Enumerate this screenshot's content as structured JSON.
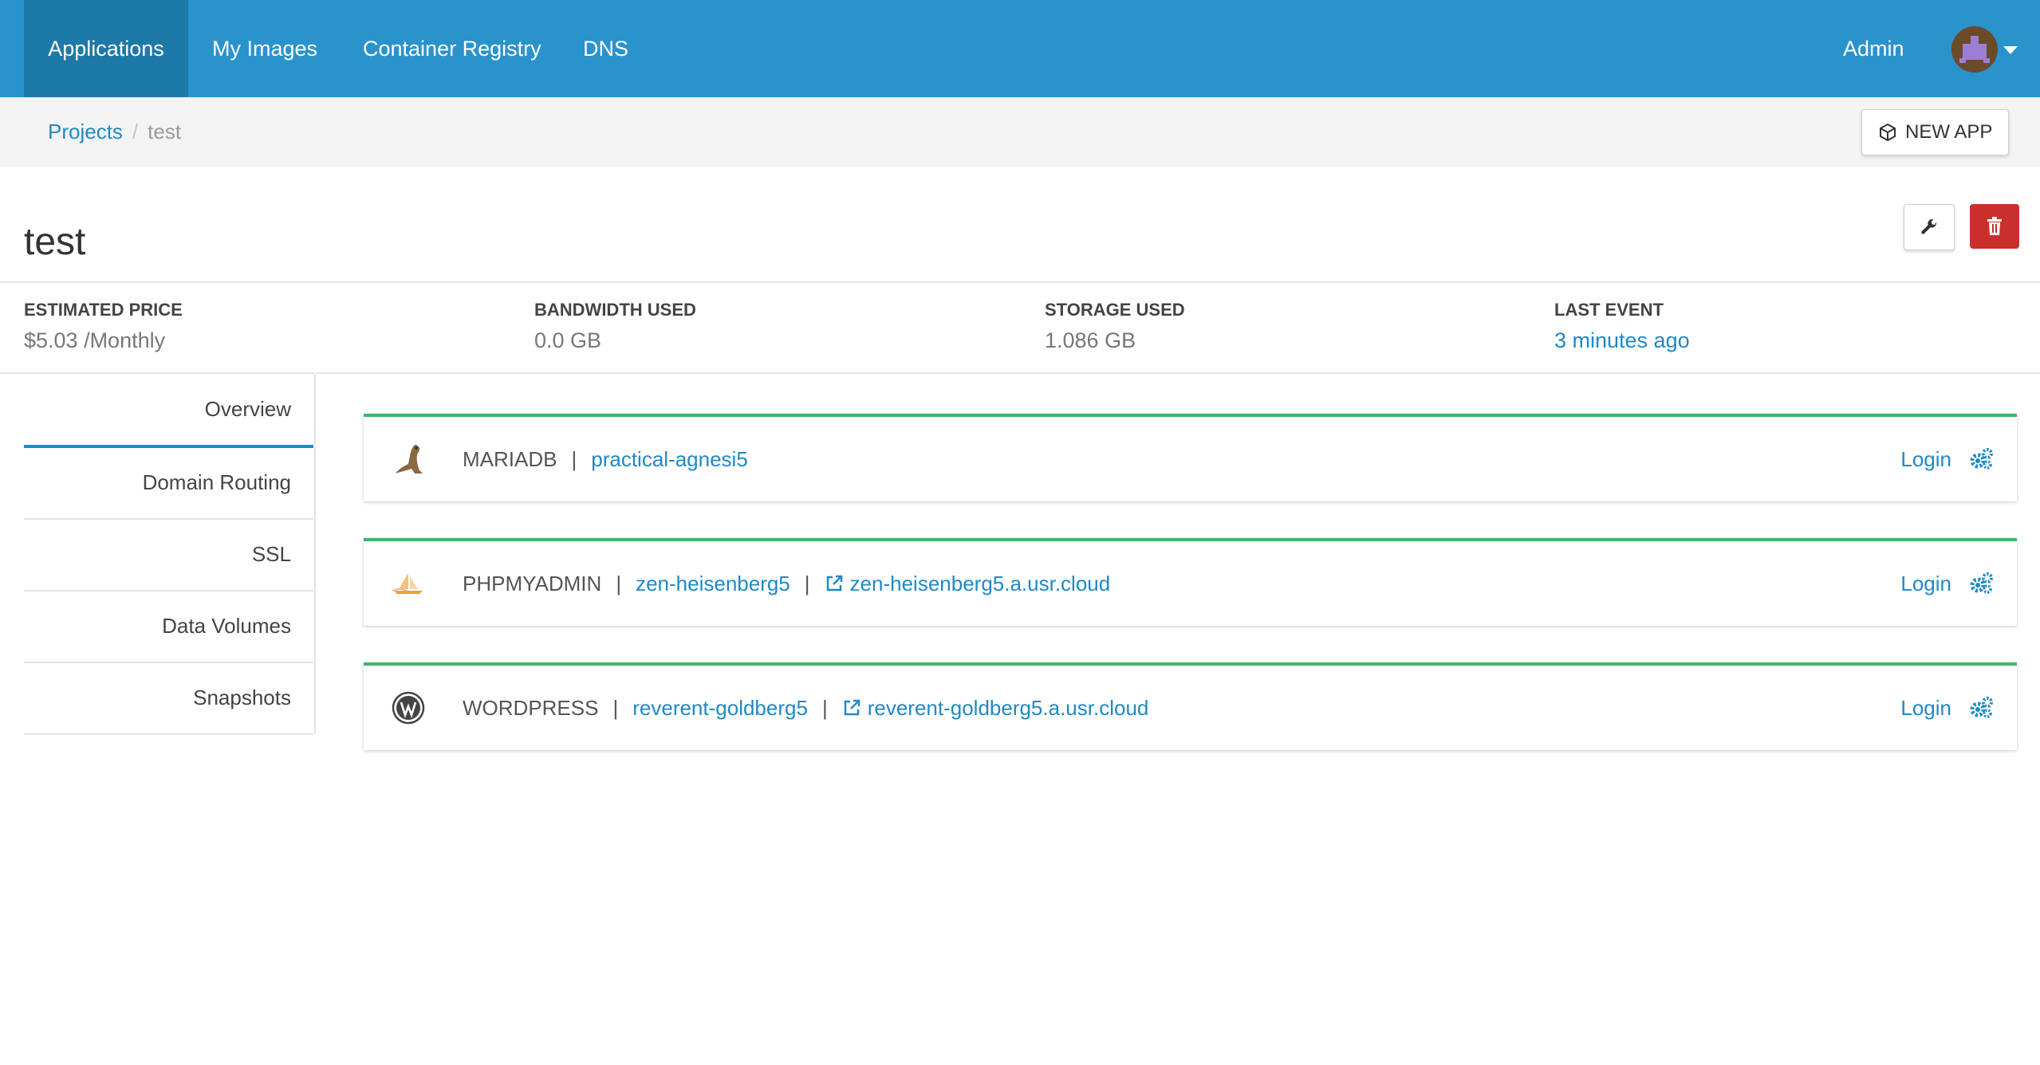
{
  "nav": {
    "items": [
      "Applications",
      "My Images",
      "Container Registry",
      "DNS"
    ],
    "active": "Applications",
    "user": "Admin",
    "accent_color": "#2a93cc"
  },
  "breadcrumb": {
    "root": "Projects",
    "separator": "/",
    "current": "test"
  },
  "actions": {
    "new_app_label": "NEW APP"
  },
  "project": {
    "title": "test"
  },
  "stats": {
    "estimated_price": {
      "label": "ESTIMATED PRICE",
      "value": "$5.03 /Monthly"
    },
    "bandwidth": {
      "label": "BANDWIDTH USED",
      "value": "0.0 GB"
    },
    "storage": {
      "label": "STORAGE USED",
      "value": "1.086 GB"
    },
    "last_event": {
      "label": "LAST EVENT",
      "value": "3 minutes ago"
    }
  },
  "sidebar": {
    "items": [
      "Overview",
      "Domain Routing",
      "SSL",
      "Data Volumes",
      "Snapshots"
    ],
    "active": "Overview"
  },
  "apps": [
    {
      "name": "MARIADB",
      "instance": "practical-agnesi5",
      "url": "",
      "login_label": "Login",
      "icon": "seal-icon"
    },
    {
      "name": "PHPMYADMIN",
      "instance": "zen-heisenberg5",
      "url": "zen-heisenberg5.a.usr.cloud",
      "login_label": "Login",
      "icon": "sailboat-icon"
    },
    {
      "name": "WORDPRESS",
      "instance": "reverent-goldberg5",
      "url": "reverent-goldberg5.a.usr.cloud",
      "login_label": "Login",
      "icon": "wordpress-icon"
    }
  ],
  "colors": {
    "link": "#1f89c6",
    "card_border": "#3fb66e",
    "delete": "#c9302c"
  }
}
